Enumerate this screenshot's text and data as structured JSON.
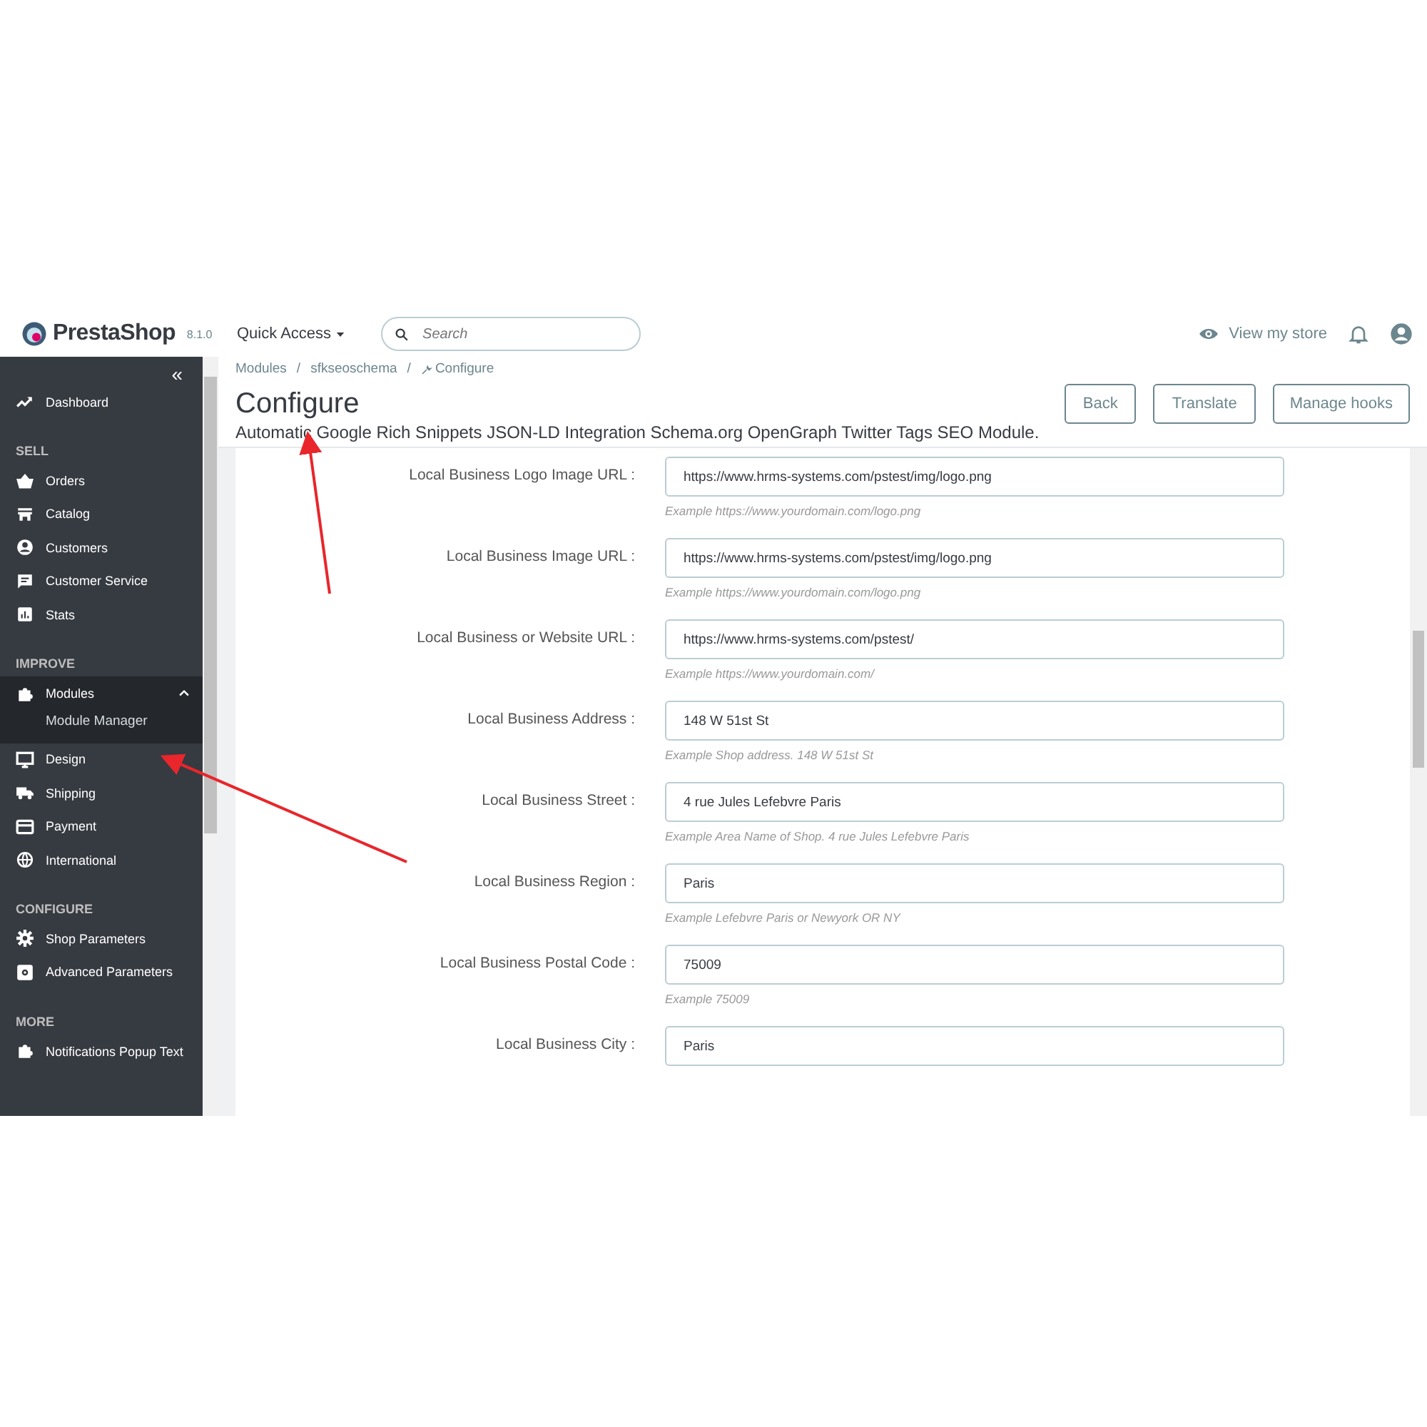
{
  "topbar": {
    "logo": "PrestaShop",
    "version": "8.1.0",
    "quick_access": "Quick Access",
    "search": {
      "placeholder": "Search"
    },
    "view_store": "View my store"
  },
  "sidebar": {
    "collapse": "«",
    "sections": [
      {
        "items": [
          {
            "label": "Dashboard",
            "expanded": false
          }
        ]
      },
      {
        "title": "SELL",
        "items": [
          {
            "label": "Orders",
            "expanded": false
          },
          {
            "label": "Catalog",
            "expanded": false
          },
          {
            "label": "Customers",
            "expanded": false
          },
          {
            "label": "Customer Service",
            "expanded": false
          },
          {
            "label": "Stats",
            "expanded": false
          }
        ]
      },
      {
        "title": "IMPROVE",
        "items": [
          {
            "label": "Modules",
            "expanded": true,
            "children": [
              {
                "label": "Module Manager",
                "selected": true
              }
            ]
          },
          {
            "label": "Design",
            "expanded": false
          },
          {
            "label": "Shipping",
            "expanded": false
          },
          {
            "label": "Payment",
            "expanded": false
          },
          {
            "label": "International",
            "expanded": false
          }
        ]
      },
      {
        "title": "CONFIGURE",
        "items": [
          {
            "label": "Shop Parameters",
            "expanded": false
          },
          {
            "label": "Advanced Parameters",
            "expanded": false
          }
        ]
      },
      {
        "title": "MORE",
        "items": [
          {
            "label": "Notifications Popup Text",
            "expanded": false
          }
        ]
      }
    ]
  },
  "breadcrumb": {
    "separator": "/",
    "items": [
      "Modules",
      "sfkseoschema",
      "Configure"
    ]
  },
  "page_title": "Configure",
  "subtitle": "Automatic Google Rich Snippets JSON-LD Integration Schema.org OpenGraph Twitter Tags SEO Module.",
  "buttons": [
    "Back",
    "Translate",
    "Manage hooks"
  ],
  "fields": [
    {
      "label": "Local Business Logo Image URL :",
      "value": "https://www.hrms-systems.com/pstest/img/logo.png",
      "hint": "Example https://www.yourdomain.com/logo.png"
    },
    {
      "label": "Local Business Image URL :",
      "value": "https://www.hrms-systems.com/pstest/img/logo.png",
      "hint": "Example https://www.yourdomain.com/logo.png"
    },
    {
      "label": "Local Business or Website URL :",
      "value": "https://www.hrms-systems.com/pstest/",
      "hint": "Example https://www.yourdomain.com/"
    },
    {
      "label": "Local Business Address :",
      "value": "148 W 51st St",
      "hint": "Example Shop address. 148 W 51st St"
    },
    {
      "label": "Local Business Street :",
      "value": "4 rue Jules Lefebvre Paris",
      "hint": "Example Area Name of Shop. 4 rue Jules Lefebvre Paris"
    },
    {
      "label": "Local Business Region :",
      "value": "Paris",
      "hint": "Example Lefebvre Paris or Newyork OR NY"
    },
    {
      "label": "Local Business Postal Code :",
      "value": "75009",
      "hint": "Example 75009"
    },
    {
      "label": "Local Business City :",
      "value": "Paris"
    }
  ]
}
